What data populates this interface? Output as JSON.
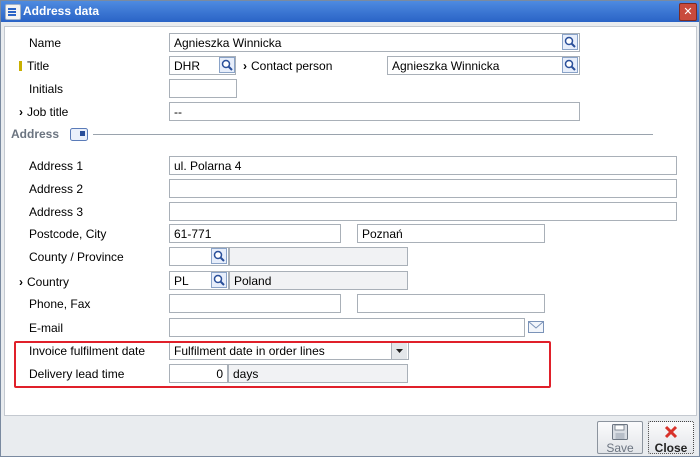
{
  "window": {
    "title": "Address data"
  },
  "fields": {
    "name": {
      "label": "Name",
      "value": "Agnieszka Winnicka"
    },
    "title": {
      "label": "Title",
      "value": "DHR"
    },
    "contact_person": {
      "label": "Contact person",
      "value": "Agnieszka Winnicka"
    },
    "initials": {
      "label": "Initials",
      "value": ""
    },
    "job_title": {
      "label": "Job title",
      "value": "--"
    }
  },
  "address_section": {
    "heading": "Address",
    "address1": {
      "label": "Address 1",
      "value": "ul. Polarna 4"
    },
    "address2": {
      "label": "Address 2",
      "value": ""
    },
    "address3": {
      "label": "Address 3",
      "value": ""
    },
    "postcode_city": {
      "label": "Postcode, City",
      "postcode": "61-771",
      "city": "Poznań"
    },
    "county": {
      "label": "County / Province",
      "code": "",
      "name": ""
    },
    "country": {
      "label": "Country",
      "code": "PL",
      "name": "Poland"
    },
    "phone_fax": {
      "label": "Phone, Fax",
      "phone": "",
      "fax": ""
    },
    "email": {
      "label": "E-mail",
      "value": ""
    }
  },
  "invoice": {
    "fulfilment_label": "Invoice fulfilment date",
    "fulfilment_value": "Fulfilment date in order lines",
    "lead_time_label": "Delivery lead time",
    "lead_time_value": "0",
    "lead_time_unit": "days"
  },
  "footer": {
    "save_label": "Save",
    "close_label": "Close"
  },
  "colors": {
    "titlebar": "#2a63c6",
    "highlight": "#e0202a",
    "required_marker": "#c9b000"
  }
}
